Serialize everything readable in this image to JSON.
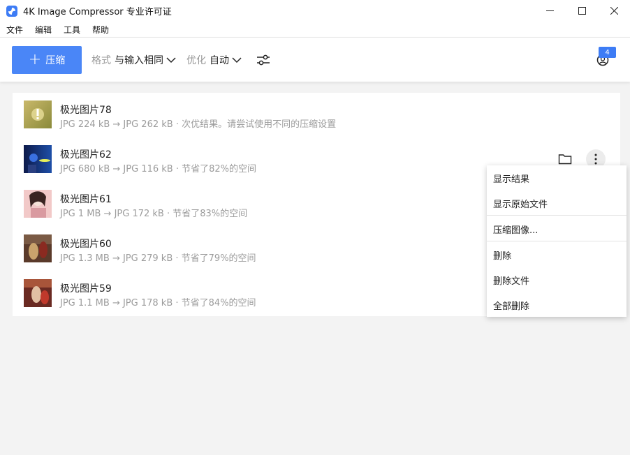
{
  "window": {
    "title": "4K Image Compressor 专业许可证",
    "app_icon": "app-logo-icon",
    "controls": [
      "minimize-icon",
      "maximize-icon",
      "close-icon"
    ]
  },
  "menu": {
    "items": [
      "文件",
      "编辑",
      "工具",
      "帮助"
    ]
  },
  "toolbar": {
    "compress_label": "压缩",
    "format_label": "格式",
    "format_value": "与输入相同",
    "optimize_label": "优化",
    "optimize_value": "自动",
    "notification_count": "4",
    "accent_color": "#4a86f7"
  },
  "files": [
    {
      "name": "极光图片78",
      "info": "JPG 224 kB → JPG 262 kB · 次优结果。请尝试使用不同的压缩设置",
      "warning": true
    },
    {
      "name": "极光图片62",
      "info": "JPG 680 kB → JPG 116 kB · 节省了82%的空间"
    },
    {
      "name": "极光图片61",
      "info": "JPG 1 MB → JPG 172 kB · 节省了83%的空间"
    },
    {
      "name": "极光图片60",
      "info": "JPG 1.3 MB → JPG 279 kB · 节省了79%的空间"
    },
    {
      "name": "极光图片59",
      "info": "JPG 1.1 MB → JPG 178 kB · 节省了84%的空间"
    }
  ],
  "context_menu": {
    "items": [
      "显示结果",
      "显示原始文件",
      "压缩图像...",
      "删除",
      "删除文件",
      "全部删除"
    ]
  }
}
